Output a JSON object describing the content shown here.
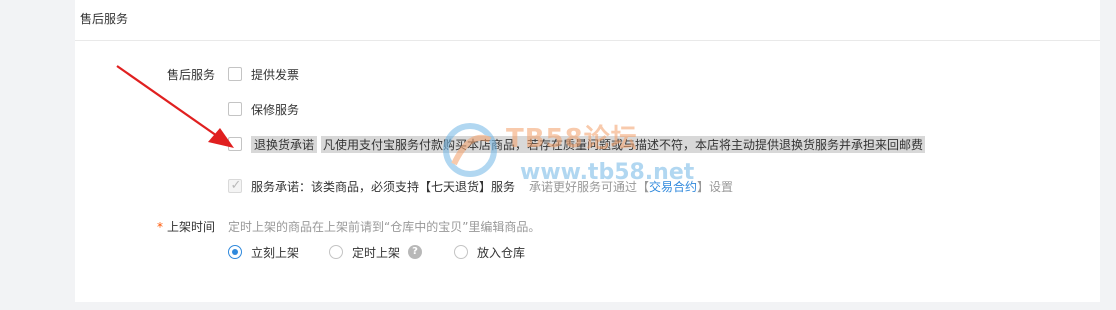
{
  "panel": {
    "title": "售后服务"
  },
  "after_sales": {
    "label": "售后服务",
    "options": [
      {
        "label": "提供发票",
        "checked": false
      },
      {
        "label": "保修服务",
        "checked": false
      },
      {
        "label": "退换货承诺",
        "checked": false,
        "description": "凡使用支付宝服务付款购买本店商品，若存在质量问题或与描述不符，本店将主动提供退换货服务并承担来回邮费"
      },
      {
        "label": "服务承诺：该类商品，必须支持【七天退货】服务",
        "checked": true,
        "disabled": true
      }
    ],
    "promise_note_prefix": "承诺更好服务可通过【",
    "promise_note_link": "交易合约",
    "promise_note_suffix": "】设置"
  },
  "listing_time": {
    "required_mark": "*",
    "label": "上架时间",
    "hint": "定时上架的商品在上架前请到“仓库中的宝贝”里编辑商品。",
    "options": [
      {
        "label": "立刻上架",
        "selected": true
      },
      {
        "label": "定时上架",
        "selected": false
      },
      {
        "label": "放入仓库",
        "selected": false
      }
    ],
    "help_icon_text": "?"
  },
  "watermark": {
    "title": "TB58论坛",
    "url": "www.tb58.net"
  },
  "colors": {
    "link": "#3089dc",
    "required": "#ff5500",
    "arrow": "#e02020",
    "watermark_orange": "#f4a06a",
    "watermark_blue": "#72b7e6"
  }
}
